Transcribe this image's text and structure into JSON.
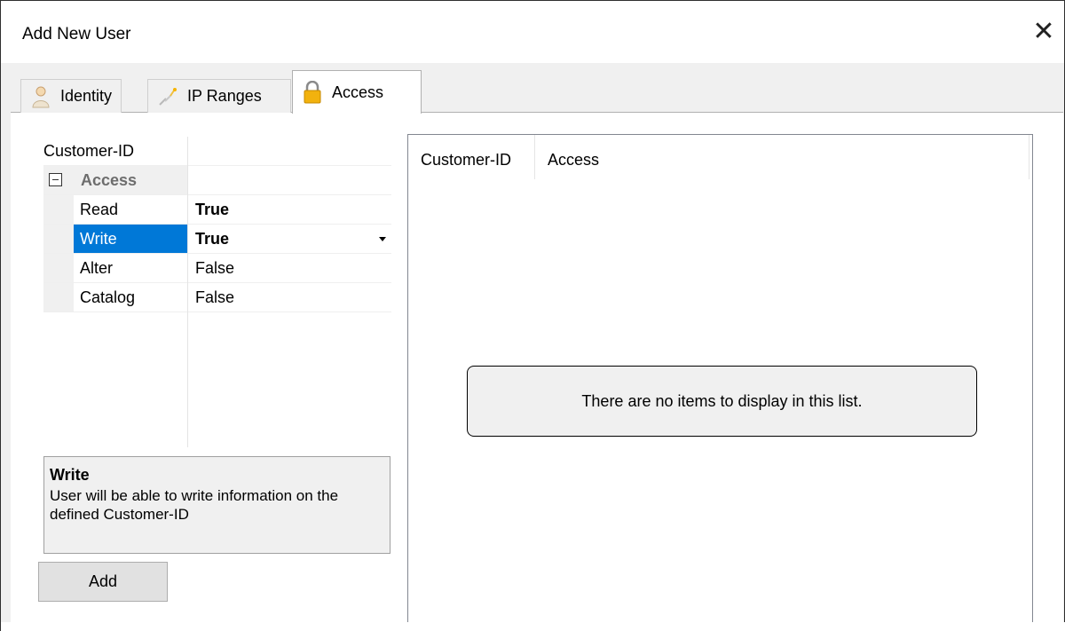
{
  "window": {
    "title": "Add New User",
    "close_glyph": "✕"
  },
  "tabs": [
    {
      "label": "Identity",
      "icon": "person-icon"
    },
    {
      "label": "IP Ranges",
      "icon": "network-icon"
    },
    {
      "label": "Access",
      "icon": "lock-icon",
      "active": true
    }
  ],
  "property_grid": {
    "rows": [
      {
        "key": "Customer-ID",
        "value": ""
      },
      {
        "key": "Access",
        "value": "",
        "category": true,
        "expanded": true
      },
      {
        "key": "Read",
        "value": "True",
        "bold": true
      },
      {
        "key": "Write",
        "value": "True",
        "bold": true,
        "selected": true,
        "dropdown": true
      },
      {
        "key": "Alter",
        "value": "False"
      },
      {
        "key": "Catalog",
        "value": "False"
      }
    ]
  },
  "description": {
    "title": "Write",
    "text": "User will be able to write information on the defined Customer-ID"
  },
  "add_button": "Add",
  "list": {
    "columns": [
      "Customer-ID",
      "Access"
    ],
    "empty_text": "There are no items to display in this list."
  },
  "colors": {
    "selection": "#0078d7",
    "window_bg": "#f0f0f0",
    "accent_lock": "#e8a400"
  }
}
